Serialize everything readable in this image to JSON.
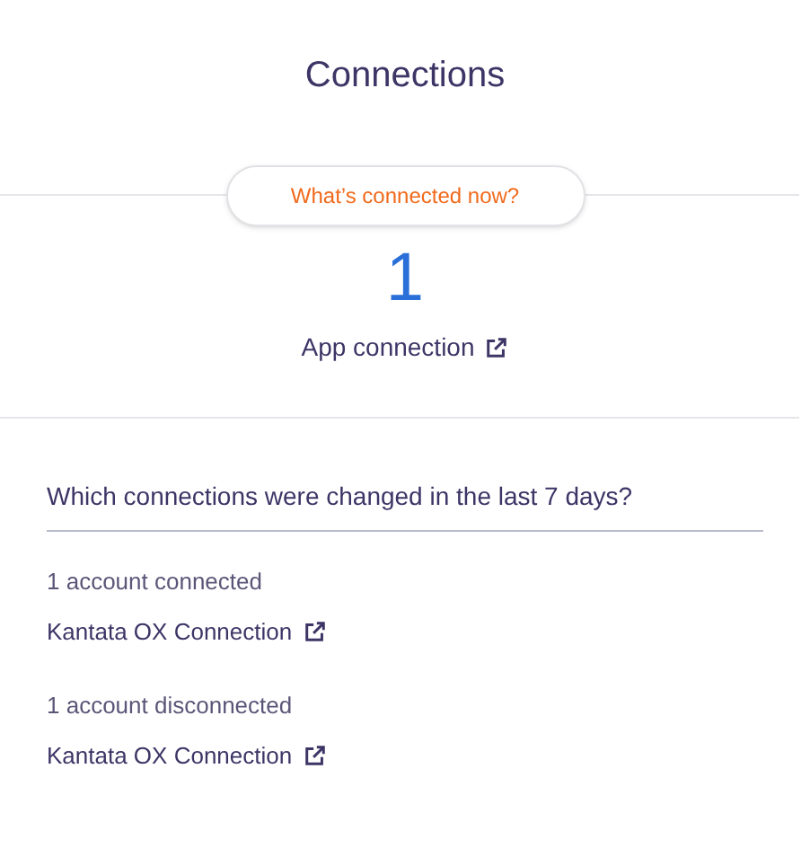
{
  "title": "Connections",
  "now": {
    "label": "What’s connected now?",
    "count": "1",
    "link": "App connection"
  },
  "changes": {
    "question": "Which connections were changed in the last 7 days?",
    "groups": [
      {
        "summary": "1 account connected",
        "link": "Kantata OX Connection"
      },
      {
        "summary": "1 account disconnected",
        "link": "Kantata OX Connection"
      }
    ]
  }
}
